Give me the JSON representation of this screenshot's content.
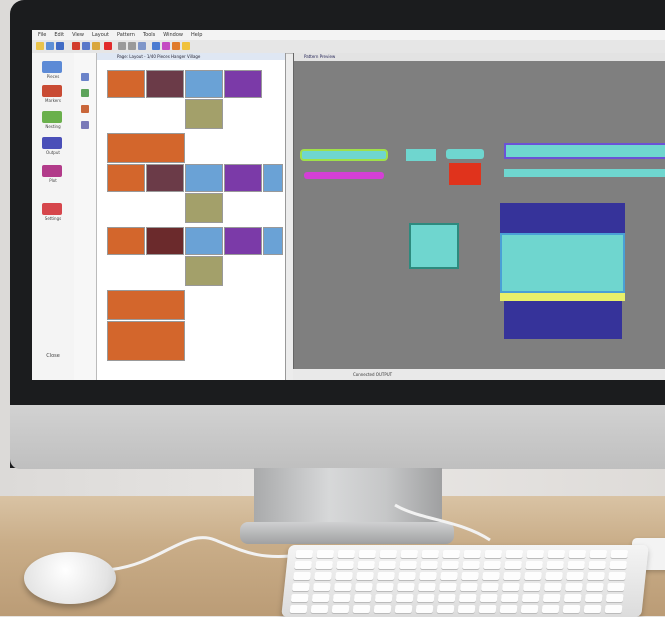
{
  "scene": {
    "colors": {
      "wall": "#e2e0de",
      "desk": "#c9ad88",
      "bezel": "#1b1c1e",
      "chin": "#c9c9c9",
      "preview_bg": "#7f7f7f",
      "piece_orange": "#d3662c",
      "piece_purple": "#7b3aa8",
      "piece_olive": "#a3a06a",
      "piece_blue": "#6aa2d6",
      "piece_navy": "#36339a",
      "piece_cyan": "#6fd6cf",
      "piece_magenta": "#d43fd6",
      "piece_red": "#e0331c"
    }
  },
  "app": {
    "menu": [
      "File",
      "Edit",
      "View",
      "Layout",
      "Pattern",
      "Tools",
      "Window",
      "Help"
    ],
    "layout_window_title": "Page: Layout - 1/40 Pieces Hanger Village",
    "preview_window_title": "Pattern Preview",
    "statusbar_text": "Connected   OUTPUT",
    "left_panel": {
      "items": [
        {
          "label": "Pieces",
          "icon": "piece-icon"
        },
        {
          "label": "Markers",
          "icon": "marker-icon"
        },
        {
          "label": "Nesting",
          "icon": "nesting-icon"
        },
        {
          "label": "Output",
          "icon": "output-icon"
        },
        {
          "label": "Plot",
          "icon": "plot-icon"
        },
        {
          "label": "Settings",
          "icon": "settings-icon"
        }
      ],
      "footer": "Close"
    }
  }
}
